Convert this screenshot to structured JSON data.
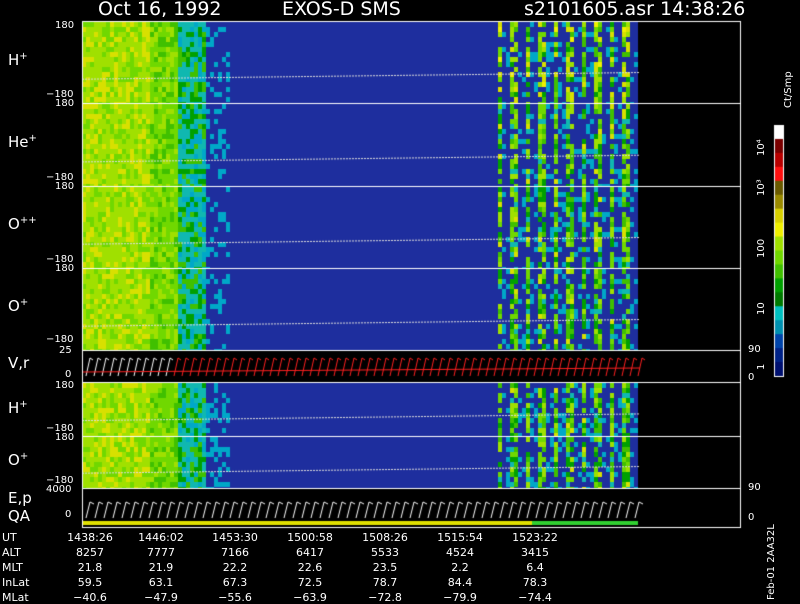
{
  "header": {
    "date": "Oct 16, 1992",
    "instrument": "EXOS-D SMS",
    "file": "s2101605.asr",
    "time": "14:38:26"
  },
  "colorbar": {
    "unit": "Ct/Smp",
    "labels": [
      "10⁴",
      "10³",
      "100",
      "10",
      "1"
    ],
    "colors": [
      "#ffffff",
      "#7a0000",
      "#b80000",
      "#ff1010",
      "#6a5a00",
      "#9a8a00",
      "#d8d000",
      "#f0f000",
      "#a0e000",
      "#70d800",
      "#40c000",
      "#00a000",
      "#007a00",
      "#00c0c0",
      "#0090b0",
      "#0044aa",
      "#002288",
      "#001070"
    ]
  },
  "panels": [
    {
      "label": "H",
      "sup": "+",
      "ymax": "180",
      "ymin": "−180"
    },
    {
      "label": "He",
      "sup": "+",
      "ymax": "180",
      "ymin": "−180"
    },
    {
      "label": "O",
      "sup": "++",
      "ymax": "180",
      "ymin": "−180"
    },
    {
      "label": "O",
      "sup": "+",
      "ymax": "180",
      "ymin": "−180"
    },
    {
      "label": "V,r",
      "sup": "",
      "ymax": "25",
      "ymin": "0",
      "rtop": "90",
      "rbot": "0"
    },
    {
      "label": "H",
      "sup": "+",
      "ymax": "180",
      "ymin": "−180"
    },
    {
      "label": "O",
      "sup": "+",
      "ymax": "180",
      "ymin": "−180"
    },
    {
      "label": "E,p",
      "sup": "",
      "label2": "QA",
      "ymax": "4000",
      "ymin": "0",
      "rtop": "90",
      "rbot": "0"
    }
  ],
  "ephemeris": {
    "labels": [
      "UT",
      "ALT",
      "MLT",
      "InLat",
      "MLat"
    ],
    "UT": [
      "1438:26",
      "1446:02",
      "1453:30",
      "1500:58",
      "1508:26",
      "1515:54",
      "1523:22"
    ],
    "ALT": [
      "8257",
      "7777",
      "7166",
      "6417",
      "5533",
      "4524",
      "3415"
    ],
    "MLT": [
      "21.8",
      "21.9",
      "22.2",
      "22.6",
      "23.5",
      "2.2",
      "6.4"
    ],
    "InLat": [
      "59.5",
      "63.1",
      "67.3",
      "72.5",
      "78.7",
      "84.4",
      "78.3"
    ],
    "MLat": [
      "−40.6",
      "−47.9",
      "−55.6",
      "−63.9",
      "−72.8",
      "−79.9",
      "−74.4"
    ]
  },
  "footer": "Feb-01 2AA32L",
  "chart_data": {
    "type": "heatmap",
    "title": "Oct 16, 1992   EXOS-D SMS",
    "panel_names": [
      "H+",
      "He+",
      "O++",
      "O+",
      "V,r",
      "H+",
      "O+",
      "E,p QA"
    ],
    "x": [
      "1438:26",
      "1446:02",
      "1453:30",
      "1500:58",
      "1508:26",
      "1515:54",
      "1523:22"
    ],
    "color_scale": "log",
    "color_range": [
      1,
      10000
    ],
    "ylim_pitch_angle": [
      -180,
      180
    ]
  }
}
